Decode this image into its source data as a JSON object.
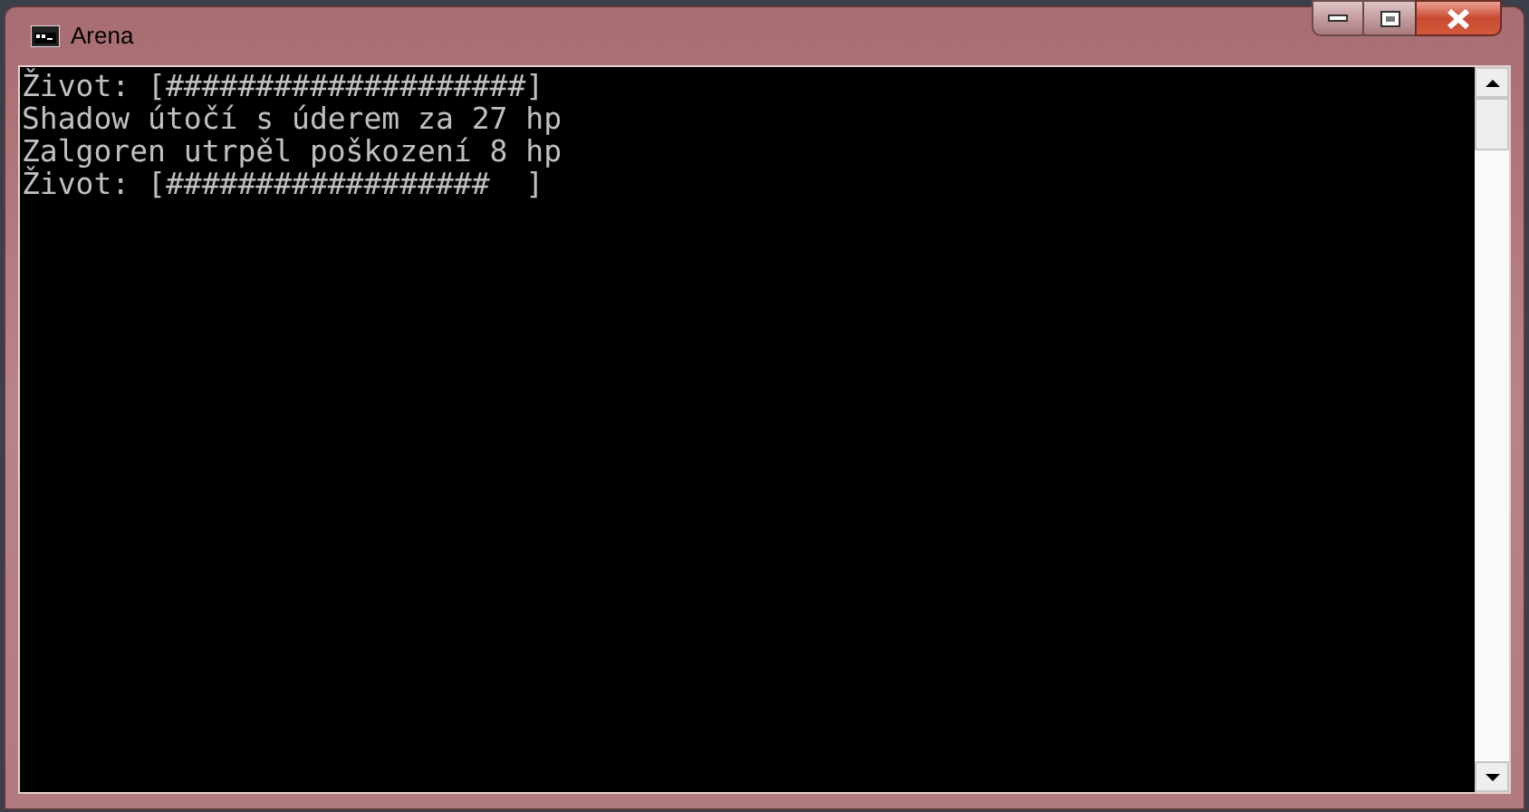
{
  "window": {
    "title": "Arena"
  },
  "console": {
    "lines": [
      "Život: [####################]",
      "Shadow útočí s úderem za 27 hp",
      "Zalgoren utrpěl poškození 8 hp",
      "Život: [##################  ]"
    ]
  }
}
